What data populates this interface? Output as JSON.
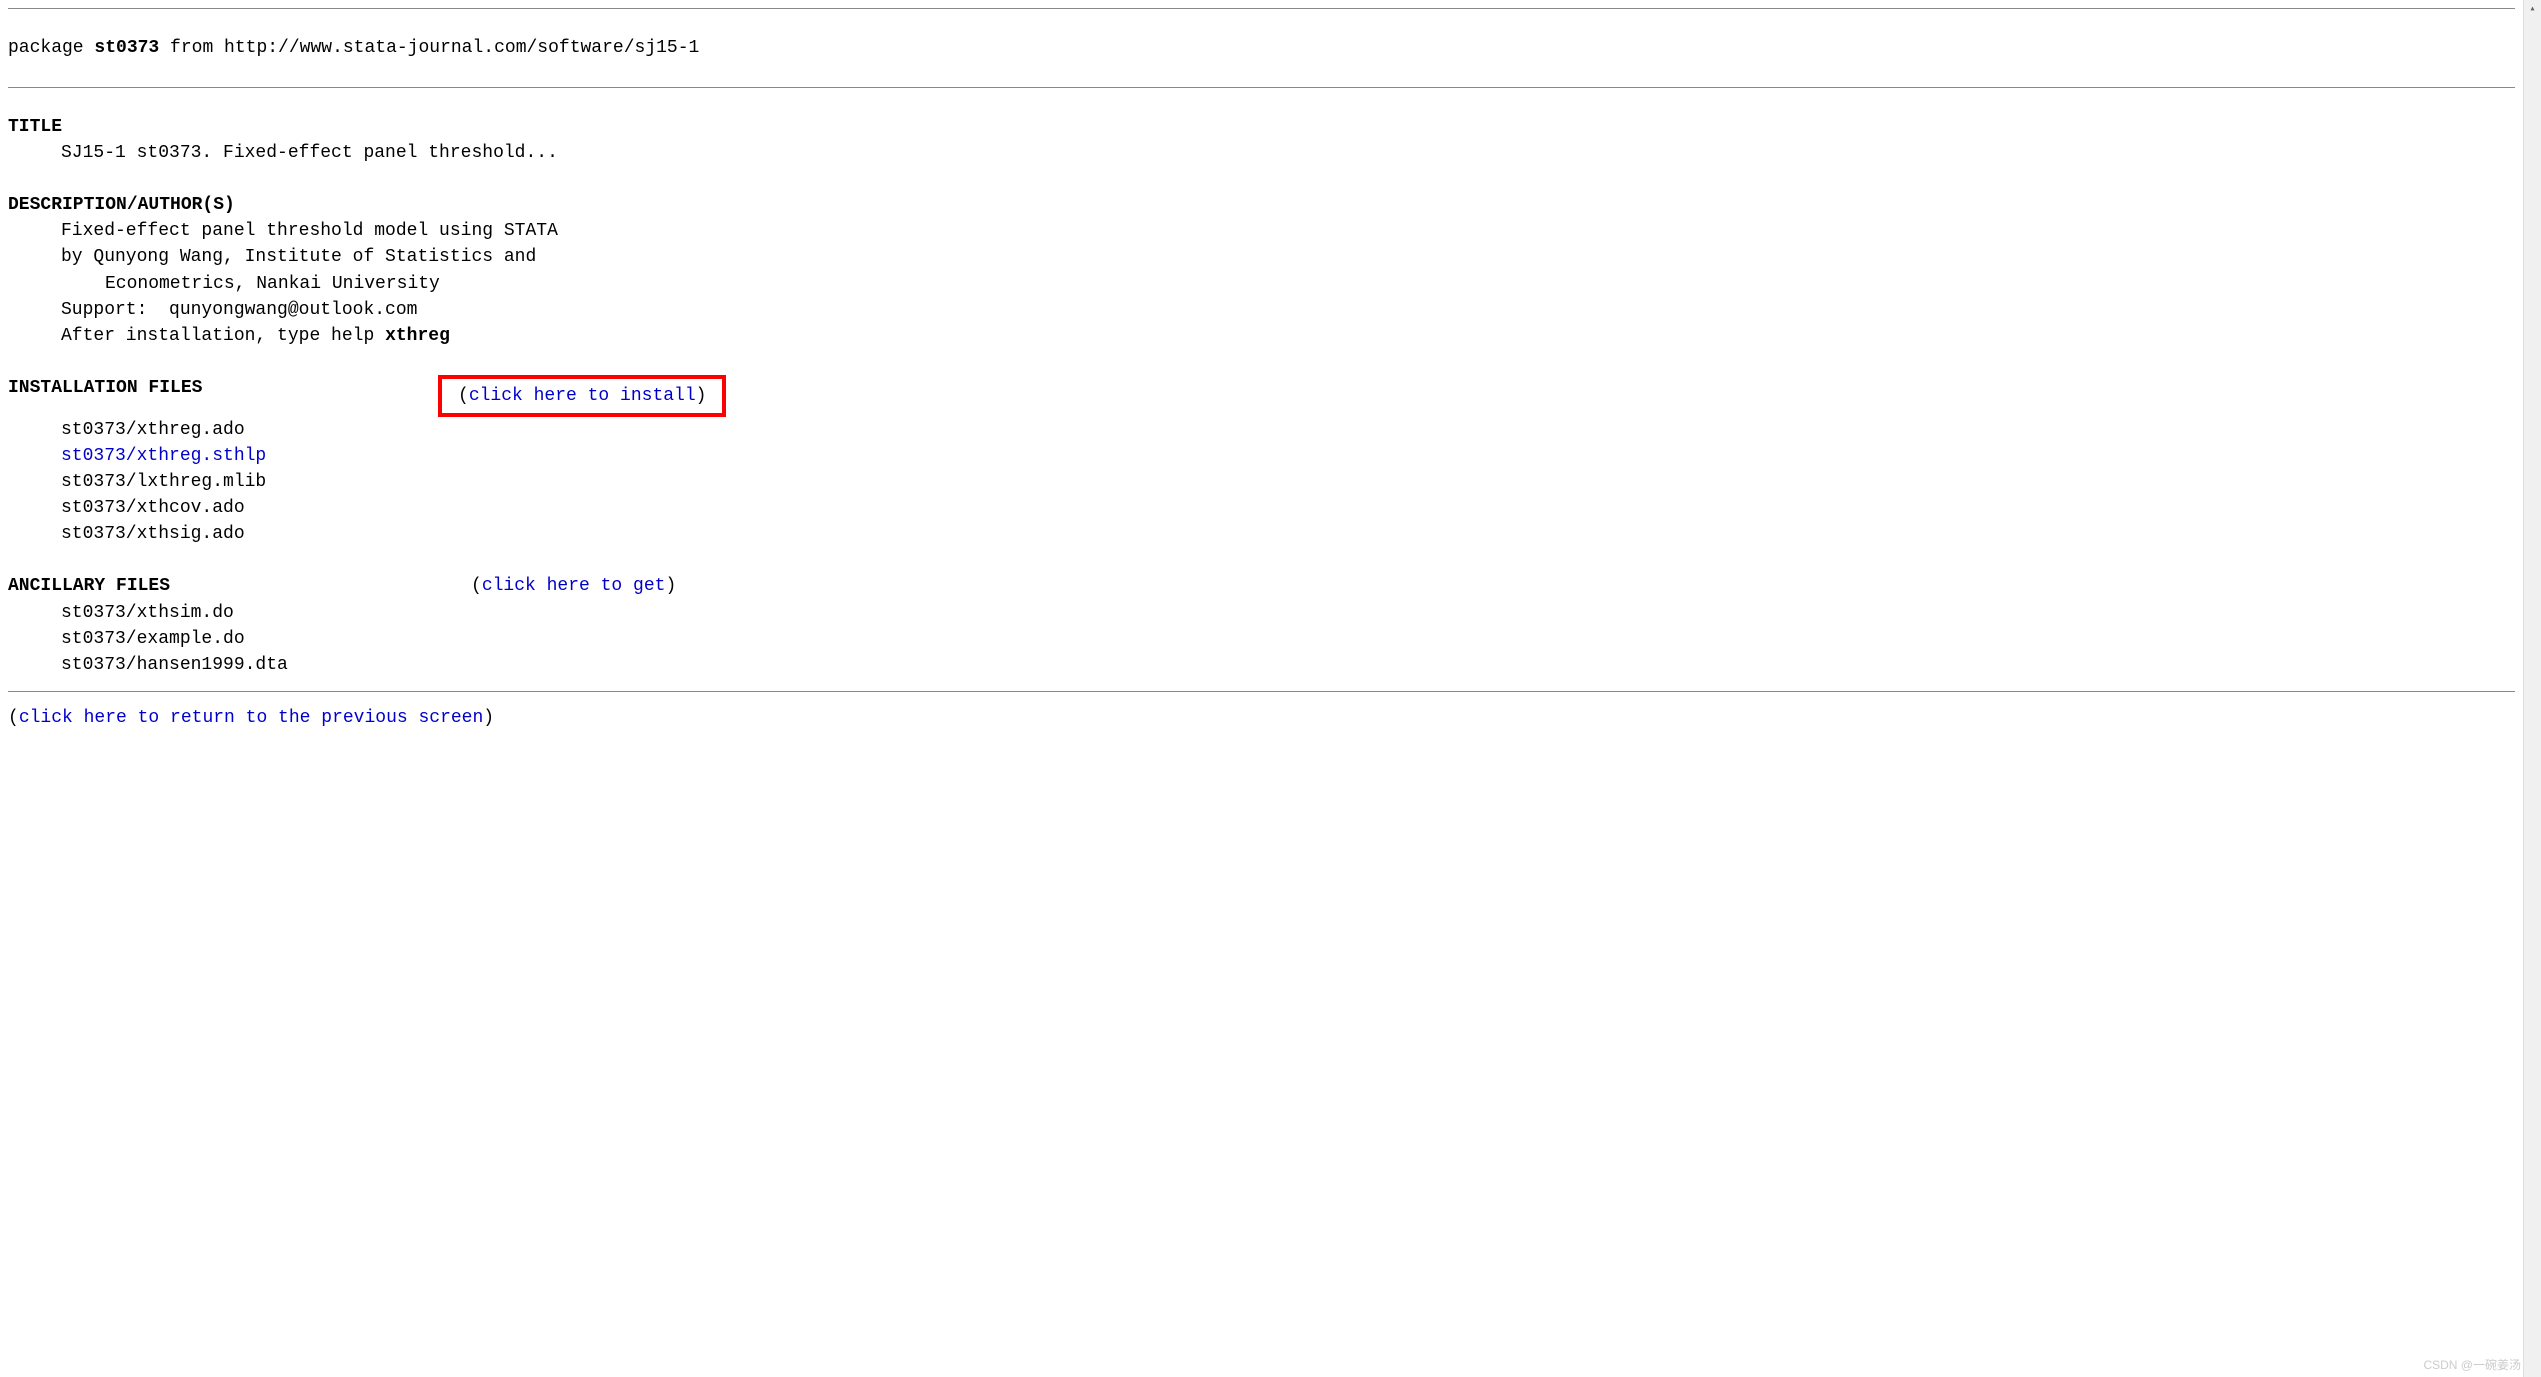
{
  "header": {
    "package_prefix": "package ",
    "package_name": "st0373",
    "from_prefix": " from ",
    "source_url": "http://www.stata-journal.com/software/sj15-1"
  },
  "title_section": {
    "label": "TITLE",
    "text": "SJ15-1 st0373. Fixed-effect panel threshold..."
  },
  "description_section": {
    "label": "DESCRIPTION/AUTHOR(S)",
    "line1": "Fixed-effect panel threshold model using STATA",
    "line2": "by Qunyong Wang, Institute of Statistics and",
    "line3": "Econometrics, Nankai University",
    "line4": "Support:  qunyongwang@outlook.com",
    "line5_prefix": "After installation, type help ",
    "line5_bold": "xthreg"
  },
  "installation_section": {
    "label": "INSTALLATION FILES",
    "click_open": "(",
    "click_text": "click here to install",
    "click_close": ")",
    "files": {
      "f0": "st0373/xthreg.ado",
      "f1": "st0373/xthreg.sthlp",
      "f2": "st0373/lxthreg.mlib",
      "f3": "st0373/xthcov.ado",
      "f4": "st0373/xthsig.ado"
    }
  },
  "ancillary_section": {
    "label": "ANCILLARY FILES",
    "click_open": "(",
    "click_text": "click here to get",
    "click_close": ")",
    "files": {
      "f0": "st0373/xthsim.do",
      "f1": "st0373/example.do",
      "f2": "st0373/hansen1999.dta"
    }
  },
  "footer": {
    "open": "(",
    "link_text": "click here to return to the previous screen",
    "close": ")"
  },
  "watermark": "CSDN @一碗姜汤"
}
